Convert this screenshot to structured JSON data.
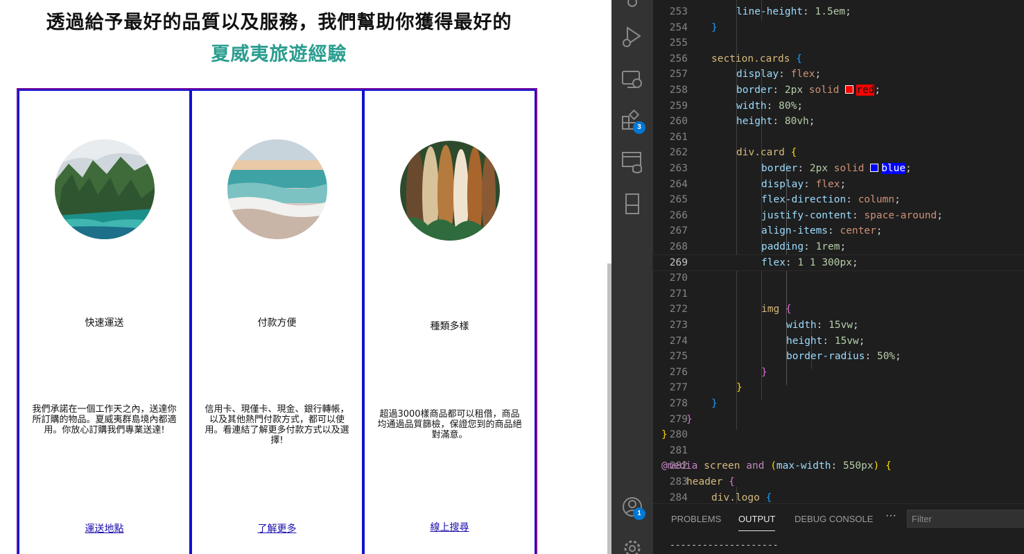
{
  "preview": {
    "headline_line1": "透過給予最好的品質以及服務，我們幫助你獲得最好的",
    "headline_line2": "夏威夷旅遊經驗",
    "headline_accent_color": "#2a9d8f",
    "cards": [
      {
        "title": "快速運送",
        "text": "我們承諾在一個工作天之內，送達你所訂購的物品。夏威夷群島境內都適用。你放心訂購我們專業送達!",
        "link": "運送地點",
        "image": "mountain-coast-photo"
      },
      {
        "title": "付款方便",
        "text": "信用卡、現僅卡、現金、銀行轉帳，以及其他熱門付款方式，都可以使用。看連結了解更多付款方式以及選擇!",
        "link": "了解更多",
        "image": "beach-waves-photo"
      },
      {
        "title": "種類多樣",
        "text": "超過3000樣商品都可以租借，商品均通過品質篩檢，保證您到的商品絕對滿意。",
        "link": "線上搜尋",
        "image": "surfboards-photo"
      }
    ]
  },
  "vscode": {
    "activity_badges": {
      "extensions": "3",
      "accounts": "1"
    },
    "current_line": "269",
    "lines": [
      {
        "n": "253",
        "text": "line-height: 1.5em;"
      },
      {
        "n": "254",
        "text": "}"
      },
      {
        "n": "255",
        "text": ""
      },
      {
        "n": "256",
        "text": "section.cards {"
      },
      {
        "n": "257",
        "text": "display: flex;"
      },
      {
        "n": "258",
        "text": "border: 2px solid red;"
      },
      {
        "n": "259",
        "text": "width: 80%;"
      },
      {
        "n": "260",
        "text": "height: 80vh;"
      },
      {
        "n": "261",
        "text": ""
      },
      {
        "n": "262",
        "text": "div.card {"
      },
      {
        "n": "263",
        "text": "border: 2px solid blue;"
      },
      {
        "n": "264",
        "text": "display: flex;"
      },
      {
        "n": "265",
        "text": "flex-direction: column;"
      },
      {
        "n": "266",
        "text": "justify-content: space-around;"
      },
      {
        "n": "267",
        "text": "align-items: center;"
      },
      {
        "n": "268",
        "text": "padding: 1rem;"
      },
      {
        "n": "269",
        "text": "flex: 1 1 300px;"
      },
      {
        "n": "270",
        "text": ""
      },
      {
        "n": "271",
        "text": ""
      },
      {
        "n": "272",
        "text": "img {"
      },
      {
        "n": "273",
        "text": "width: 15vw;"
      },
      {
        "n": "274",
        "text": "height: 15vw;"
      },
      {
        "n": "275",
        "text": "border-radius: 50%;"
      },
      {
        "n": "276",
        "text": "}"
      },
      {
        "n": "277",
        "text": "}"
      },
      {
        "n": "278",
        "text": "}"
      },
      {
        "n": "279",
        "text": "}"
      },
      {
        "n": "280",
        "text": "}"
      },
      {
        "n": "281",
        "text": ""
      },
      {
        "n": "282",
        "text": "@media screen and (max-width: 550px) {"
      },
      {
        "n": "283",
        "text": "header {"
      },
      {
        "n": "284",
        "text": "div.logo {"
      }
    ],
    "panel": {
      "tabs": [
        "PROBLEMS",
        "OUTPUT",
        "DEBUG CONSOLE"
      ],
      "active_tab": "OUTPUT",
      "more": "···",
      "filter_placeholder": "Filter",
      "output_dashes": "--------------------"
    },
    "colors": {
      "red_swatch": "#ff0000",
      "blue_swatch": "#0000ff"
    }
  }
}
